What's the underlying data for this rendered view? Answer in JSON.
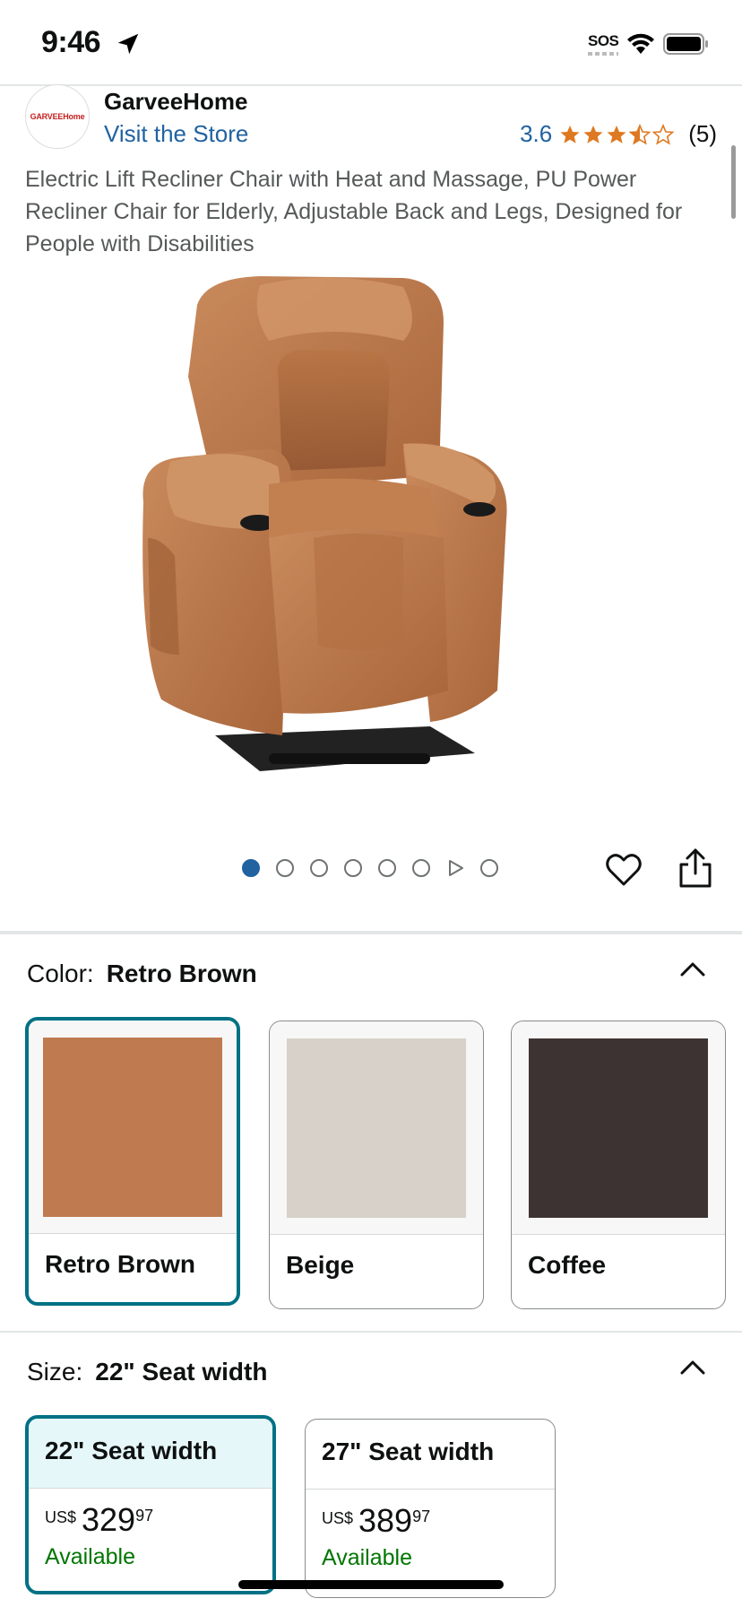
{
  "status_bar": {
    "time": "9:46",
    "sos": "SOS"
  },
  "brand": {
    "logo_text": "GARVEEHome",
    "name": "GarveeHome",
    "visit_store": "Visit the Store",
    "rating": "3.6",
    "rating_count": "(5)",
    "stars_filled": 3.5,
    "stars_total": 5
  },
  "product": {
    "title": "Electric Lift Recliner Chair with Heat and Massage, PU Power Recliner Chair for Elderly, Adjustable Back and Legs, Designed for People with Disabilities"
  },
  "carousel": {
    "total": 8,
    "active": 0,
    "video_index": 6
  },
  "color": {
    "label": "Color:",
    "selected": "Retro Brown",
    "options": [
      {
        "label": "Retro Brown",
        "swatch": "#c07a4f"
      },
      {
        "label": "Beige",
        "swatch": "#d7d1c9"
      },
      {
        "label": "Coffee",
        "swatch": "#3e3333"
      }
    ]
  },
  "size": {
    "label": "Size:",
    "selected": "22\" Seat width",
    "options": [
      {
        "label": "22\" Seat width",
        "currency": "US$",
        "price_whole": "329",
        "price_frac": "97",
        "availability": "Available"
      },
      {
        "label": "27\" Seat width",
        "currency": "US$",
        "price_whole": "389",
        "price_frac": "97",
        "availability": "Available"
      }
    ]
  },
  "colors": {
    "accent": "#007185",
    "link": "#2162a1",
    "star": "#de7921",
    "available": "#007600"
  }
}
